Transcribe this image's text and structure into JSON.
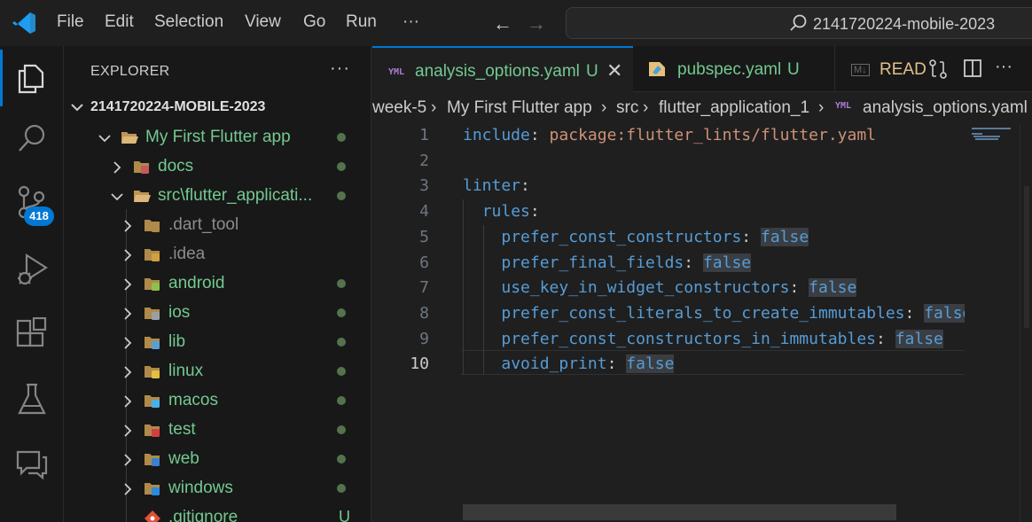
{
  "titlebar": {
    "menu": [
      "File",
      "Edit",
      "Selection",
      "View",
      "Go",
      "Run"
    ],
    "more": "···",
    "search_text": "2141720224-mobile-2023"
  },
  "activitybar": {
    "items": [
      "explorer-icon",
      "search-icon",
      "source-control-icon",
      "run-debug-icon",
      "extensions-icon",
      "testing-icon",
      "chat-icon"
    ],
    "scm_badge": "418"
  },
  "explorer": {
    "title": "EXPLORER",
    "more": "···",
    "root": "2141720224-MOBILE-2023",
    "items": [
      {
        "label": "My First Flutter app",
        "depth": 1,
        "open": true,
        "color": "#73c991",
        "status": "dot"
      },
      {
        "label": "docs",
        "depth": 2,
        "open": false,
        "color": "#73c991",
        "status": "dot"
      },
      {
        "label": "src\\flutter_applicati...",
        "depth": 2,
        "open": true,
        "color": "#73c991",
        "status": "dot"
      },
      {
        "label": ".dart_tool",
        "depth": 3,
        "open": false,
        "color": "#8c8c8c",
        "status": ""
      },
      {
        "label": ".idea",
        "depth": 3,
        "open": false,
        "color": "#8c8c8c",
        "status": ""
      },
      {
        "label": "android",
        "depth": 3,
        "open": false,
        "color": "#73c991",
        "status": "dot"
      },
      {
        "label": "ios",
        "depth": 3,
        "open": false,
        "color": "#73c991",
        "status": "dot"
      },
      {
        "label": "lib",
        "depth": 3,
        "open": false,
        "color": "#73c991",
        "status": "dot"
      },
      {
        "label": "linux",
        "depth": 3,
        "open": false,
        "color": "#73c991",
        "status": "dot"
      },
      {
        "label": "macos",
        "depth": 3,
        "open": false,
        "color": "#73c991",
        "status": "dot"
      },
      {
        "label": "test",
        "depth": 3,
        "open": false,
        "color": "#73c991",
        "status": "dot"
      },
      {
        "label": "web",
        "depth": 3,
        "open": false,
        "color": "#73c991",
        "status": "dot"
      },
      {
        "label": "windows",
        "depth": 3,
        "open": false,
        "color": "#73c991",
        "status": "dot"
      },
      {
        "label": ".gitignore",
        "depth": 3,
        "open": false,
        "color": "#73c991",
        "status": "U"
      }
    ]
  },
  "tabs": [
    {
      "label": "analysis_options.yaml",
      "status": "U",
      "active": true
    },
    {
      "label": "pubspec.yaml",
      "status": "U",
      "active": false
    },
    {
      "label": "READ",
      "status": "",
      "active": false
    }
  ],
  "breadcrumbs": [
    "week-5",
    "My First Flutter app",
    "src",
    "flutter_application_1",
    "analysis_options.yaml"
  ],
  "editor": {
    "current_line": 10,
    "lines": [
      {
        "n": "1",
        "tokens": [
          [
            "k",
            "include"
          ],
          [
            "p",
            ": "
          ],
          [
            "s",
            "package:flutter_lints/flutter.yaml"
          ]
        ]
      },
      {
        "n": "2",
        "tokens": []
      },
      {
        "n": "3",
        "tokens": [
          [
            "k",
            "linter"
          ],
          [
            "p",
            ":"
          ]
        ]
      },
      {
        "n": "4",
        "tokens": [
          [
            "p",
            "  "
          ],
          [
            "k",
            "rules"
          ],
          [
            "p",
            ":"
          ]
        ]
      },
      {
        "n": "5",
        "tokens": [
          [
            "p",
            "    "
          ],
          [
            "k",
            "prefer_const_constructors"
          ],
          [
            "p",
            ": "
          ],
          [
            "b",
            "false"
          ]
        ]
      },
      {
        "n": "6",
        "tokens": [
          [
            "p",
            "    "
          ],
          [
            "k",
            "prefer_final_fields"
          ],
          [
            "p",
            ": "
          ],
          [
            "b",
            "false"
          ]
        ]
      },
      {
        "n": "7",
        "tokens": [
          [
            "p",
            "    "
          ],
          [
            "k",
            "use_key_in_widget_constructors"
          ],
          [
            "p",
            ": "
          ],
          [
            "b",
            "false"
          ]
        ]
      },
      {
        "n": "8",
        "tokens": [
          [
            "p",
            "    "
          ],
          [
            "k",
            "prefer_const_literals_to_create_immutables"
          ],
          [
            "p",
            ": "
          ],
          [
            "b",
            "false"
          ]
        ]
      },
      {
        "n": "9",
        "tokens": [
          [
            "p",
            "    "
          ],
          [
            "k",
            "prefer_const_constructors_in_immutables"
          ],
          [
            "p",
            ": "
          ],
          [
            "b",
            "false"
          ]
        ]
      },
      {
        "n": "10",
        "tokens": [
          [
            "p",
            "    "
          ],
          [
            "k",
            "avoid_print"
          ],
          [
            "p",
            ": "
          ],
          [
            "b",
            "false"
          ]
        ]
      }
    ]
  }
}
